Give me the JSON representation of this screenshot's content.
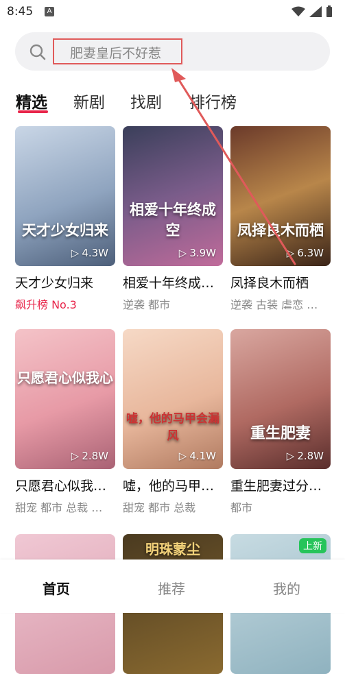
{
  "status_bar": {
    "time": "8:45",
    "notif_icon": "A"
  },
  "search": {
    "placeholder": "肥妻皇后不好惹"
  },
  "tabs": [
    {
      "label": "精选",
      "active": true
    },
    {
      "label": "新剧"
    },
    {
      "label": "找剧"
    },
    {
      "label": "排行榜"
    }
  ],
  "cards": [
    {
      "name": "天才少女归来",
      "sub": "飙升榜 No.3",
      "plays": "4.3W",
      "poster_text": "天才少女归来"
    },
    {
      "name": "相爱十年终成…",
      "sub": "逆袭 都市",
      "plays": "3.9W",
      "poster_text": "相爱十年终成空"
    },
    {
      "name": "凤择良木而栖",
      "sub": "逆袭 古装 虐恋 …",
      "plays": "6.3W",
      "poster_text": "凤择良木而栖"
    },
    {
      "name": "只愿君心似我…",
      "sub": "甜宠 都市 总裁 …",
      "plays": "2.8W",
      "poster_text": "只愿君心似我心"
    },
    {
      "name": "嘘，他的马甲…",
      "sub": "甜宠 都市 总裁",
      "plays": "4.1W",
      "poster_text": "嘘，他的马甲会漏风"
    },
    {
      "name": "重生肥妻过分…",
      "sub": "都市",
      "plays": "2.8W",
      "poster_text": "重生肥妻"
    },
    {
      "name": "",
      "sub": "",
      "plays": "",
      "poster_text": ""
    },
    {
      "name": "",
      "sub": "",
      "plays": "",
      "poster_text": "明珠蒙尘"
    },
    {
      "name": "",
      "sub": "",
      "plays": "",
      "poster_text": "",
      "badge": "上新"
    }
  ],
  "bottom_nav": [
    {
      "label": "首页",
      "active": true
    },
    {
      "label": "推荐"
    },
    {
      "label": "我的"
    }
  ],
  "colors": {
    "accent": "#e8254a",
    "annotation": "#e05a5a",
    "badge": "#26c45a"
  }
}
